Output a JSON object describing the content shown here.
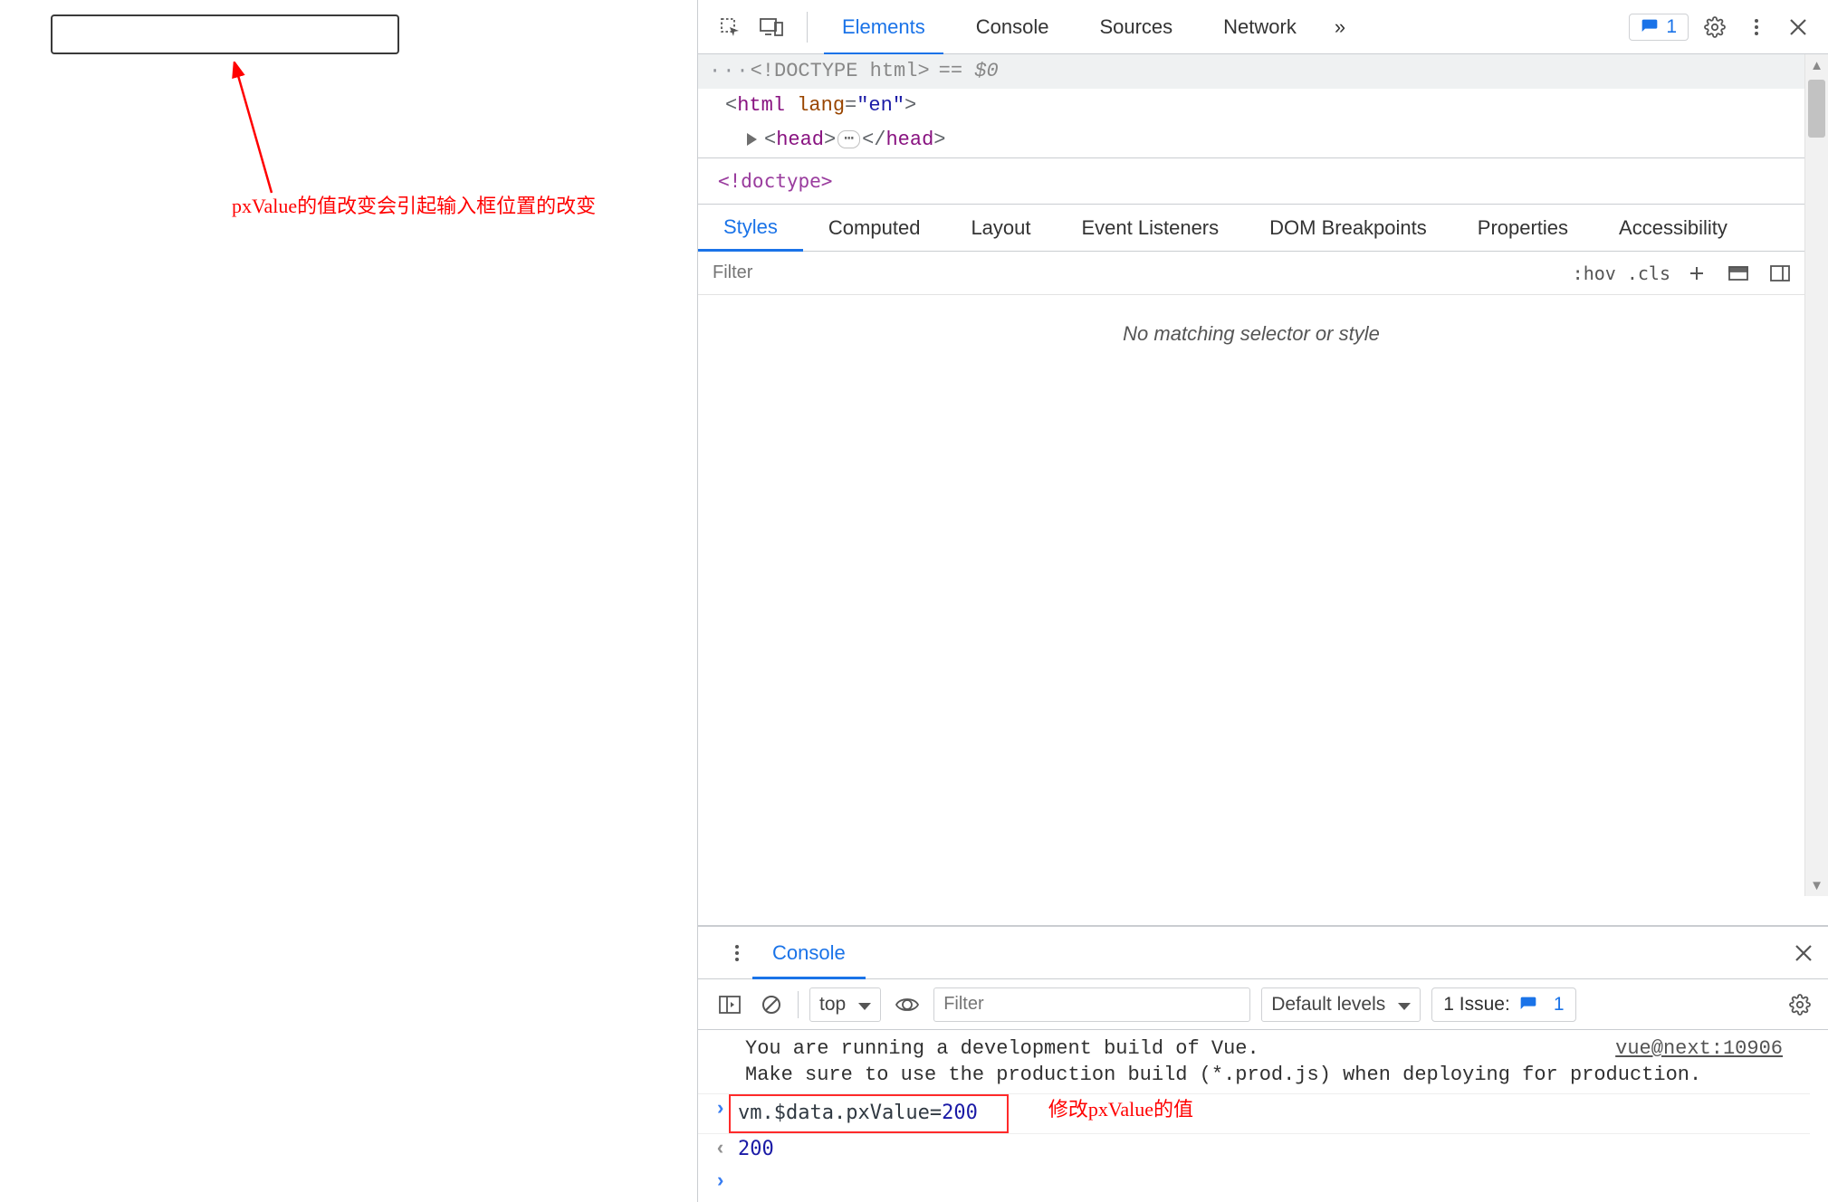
{
  "page": {
    "annotation": "pxValue的值改变会引起输入框位置的改变"
  },
  "devtools": {
    "topTabs": [
      "Elements",
      "Console",
      "Sources",
      "Network"
    ],
    "more": "»",
    "issueCount": "1",
    "dom": {
      "line1_pre": "<!DOCTYPE html>",
      "line1_eq": "== $0",
      "line2_open": "<",
      "line2_tag": "html",
      "line2_attr": "lang",
      "line2_val": "\"en\"",
      "line2_close": ">",
      "line3_open": "<",
      "line3_tag": "head",
      "line3_mid": ">",
      "line3_ell": "⋯",
      "line3_closeopen": "</",
      "line3_tag2": "head",
      "line3_close2": ">"
    },
    "crumb": "<!doctype>",
    "subTabs": [
      "Styles",
      "Computed",
      "Layout",
      "Event Listeners",
      "DOM Breakpoints",
      "Properties",
      "Accessibility"
    ],
    "filter": {
      "placeholder": "Filter",
      "hov": ":hov",
      "cls": ".cls"
    },
    "noMatch": "No matching selector or style"
  },
  "console": {
    "tab": "Console",
    "context": "top",
    "filterPlaceholder": "Filter",
    "levels": "Default levels",
    "issueLabel": "1 Issue:",
    "issueCount": "1",
    "msg1": "You are running a development build of Vue.",
    "msg2": "Make sure to use the production build (*.prod.js) when deploying for production.",
    "srcLink": "vue@next:10906",
    "input": "vm.$data.pxValue=",
    "inputNum": "200",
    "note": "修改pxValue的值",
    "output": "200"
  }
}
